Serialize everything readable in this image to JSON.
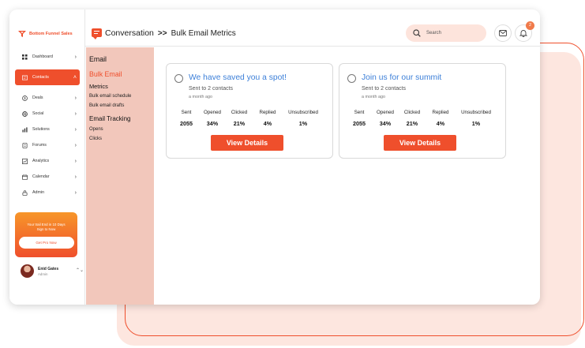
{
  "brand": {
    "name": "Bottom Funnel Sales",
    "accent": "#ef4f2c"
  },
  "nav": [
    {
      "label": "Dashboard",
      "icon": "grid-icon",
      "active": false
    },
    {
      "label": "Contacts",
      "icon": "contact-card-icon",
      "active": true
    },
    {
      "label": "Deals",
      "icon": "dollar-icon",
      "active": false
    },
    {
      "label": "Social",
      "icon": "globe-icon",
      "active": false
    },
    {
      "label": "Solutions",
      "icon": "bar-chart-icon",
      "active": false
    },
    {
      "label": "Forums",
      "icon": "document-icon",
      "active": false
    },
    {
      "label": "Analytics",
      "icon": "line-chart-icon",
      "active": false
    },
    {
      "label": "Calendar",
      "icon": "calendar-icon",
      "active": false
    },
    {
      "label": "Admin",
      "icon": "lock-icon",
      "active": false
    }
  ],
  "promo": {
    "line1": "Your trail End in 10 Days",
    "line2": "Sign to Now",
    "button": "Get Pro Now"
  },
  "user": {
    "name": "Enid Gates",
    "role": "Admin"
  },
  "header": {
    "section": "Conversation",
    "separator": ">>",
    "page": "Bulk Email Metrics"
  },
  "search": {
    "placeholder": "Search"
  },
  "notifications": {
    "count": "2"
  },
  "subnav": {
    "heading": "Email",
    "selected": "Bulk Email",
    "metrics": "Metrics",
    "schedule": "Bulk email schedule",
    "drafts": "Bulk email drafts",
    "tracking": "Email Tracking",
    "opens": "Opens",
    "clicks": "Clicks"
  },
  "stat_labels": [
    "Sent",
    "Opened",
    "Clicked",
    "Replied",
    "Unsubscribed"
  ],
  "campaigns": [
    {
      "title": "We have saved you a spot!",
      "sent_to": "Sent to 2 contacts",
      "time": "a month ago",
      "values": [
        "2055",
        "34%",
        "21%",
        "4%",
        "1%"
      ],
      "button": "View Details"
    },
    {
      "title": "Join us for our summit",
      "sent_to": "Sent to 2 contacts",
      "time": "a month ago",
      "values": [
        "2055",
        "34%",
        "21%",
        "4%",
        "1%"
      ],
      "button": "View Details"
    }
  ]
}
